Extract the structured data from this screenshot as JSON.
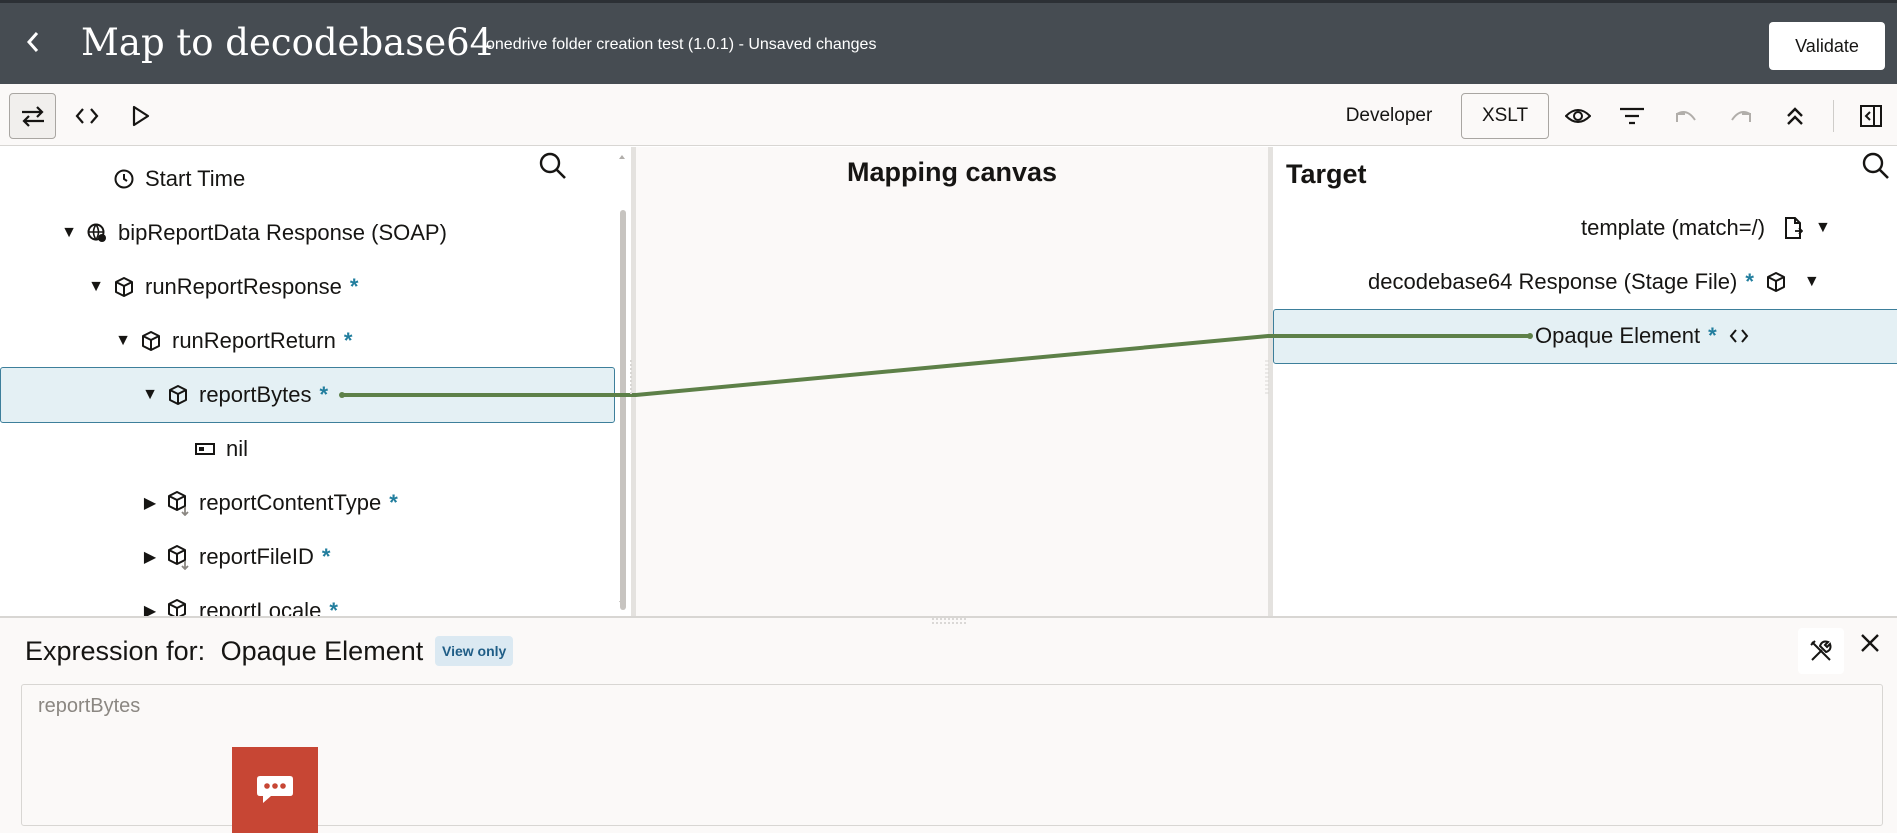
{
  "header": {
    "back_label": "‹",
    "title": "Map to decodebase64",
    "subtitle": "onedrive folder creation test (1.0.1) - Unsaved changes",
    "validate_label": "Validate"
  },
  "toolbar": {
    "developer_label": "Developer",
    "xslt_label": "XSLT"
  },
  "source_tree": [
    {
      "label": "Start Time",
      "required": false
    },
    {
      "label": "bipReportData Response (SOAP)",
      "required": false
    },
    {
      "label": "runReportResponse",
      "required": true
    },
    {
      "label": "runReportReturn",
      "required": true
    },
    {
      "label": "reportBytes",
      "required": true
    },
    {
      "label": "nil",
      "required": false
    },
    {
      "label": "reportContentType",
      "required": true
    },
    {
      "label": "reportFileID",
      "required": true
    },
    {
      "label": "reportLocale",
      "required": true
    }
  ],
  "required_mark": "*",
  "canvas": {
    "title": "Mapping canvas"
  },
  "target": {
    "title": "Target",
    "rows": [
      {
        "label": "template (match=/)"
      },
      {
        "label": "decodebase64 Response (Stage File)",
        "required": true
      },
      {
        "label": "Opaque Element",
        "required": true
      }
    ]
  },
  "expression": {
    "prefix": "Expression for:",
    "element": "Opaque Element",
    "badge": "View only",
    "value": "reportBytes",
    "close_label": "✕"
  },
  "colors": {
    "header_bg": "#464c52",
    "selection_bg": "#e4f0f4",
    "selection_border": "#3d7f9b",
    "mapping_line": "#5d8048",
    "required": "#227e9e",
    "chat_button": "#c74634"
  }
}
